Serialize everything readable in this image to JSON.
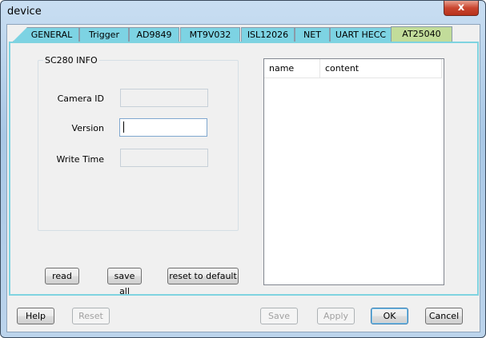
{
  "window": {
    "title": "device",
    "close_label": "x"
  },
  "tabs": [
    {
      "label": "GENERAL"
    },
    {
      "label": "Trigger"
    },
    {
      "label": "AD9849"
    },
    {
      "label": "MT9V032"
    },
    {
      "label": "ISL12026"
    },
    {
      "label": "NET"
    },
    {
      "label": "UART HECC"
    },
    {
      "label": "AT25040"
    }
  ],
  "group": {
    "title": "SC280 INFO",
    "fields": [
      {
        "label": "Camera ID",
        "value": ""
      },
      {
        "label": "Version",
        "value": ""
      },
      {
        "label": "Write Time",
        "value": ""
      }
    ]
  },
  "actions": {
    "read": "read",
    "save_all": "save all",
    "reset_default": "reset to default"
  },
  "list": {
    "columns": [
      "name",
      "content"
    ]
  },
  "footer": {
    "help": "Help",
    "reset": "Reset",
    "save": "Save",
    "apply": "Apply",
    "ok": "OK",
    "cancel": "Cancel"
  },
  "colors": {
    "tab": "#7dd3e3",
    "active_tab": "#c2dc9a",
    "page_border": "#7fd3e0"
  }
}
